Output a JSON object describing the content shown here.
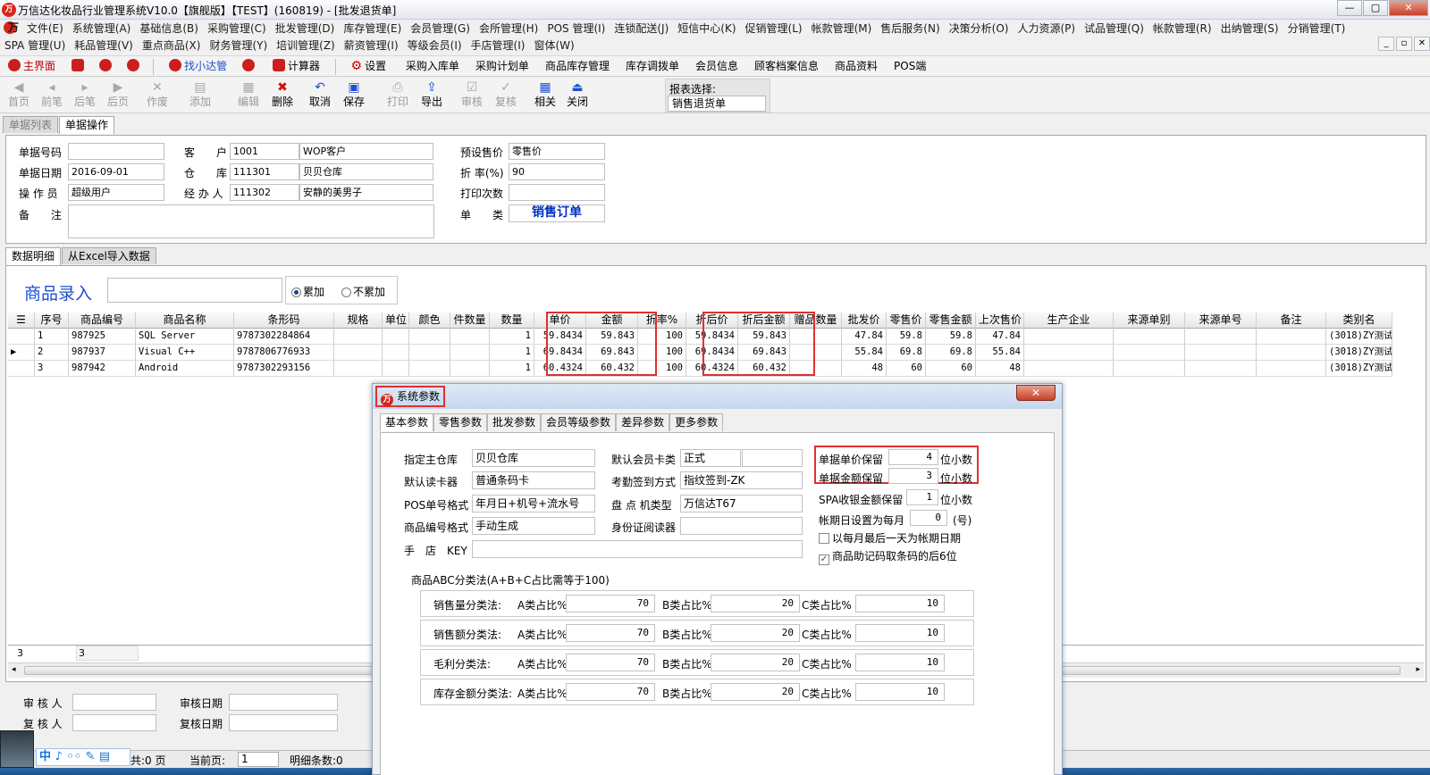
{
  "window": {
    "title": "万信达化妆品行业管理系统V10.0【旗舰版】【TEST】(160819) - [批发退货单]",
    "logo_text": "万",
    "minimize": "—",
    "maximize": "▢",
    "close": "✕"
  },
  "menu1": [
    "文件(E)",
    "系统管理(A)",
    "基础信息(B)",
    "采购管理(C)",
    "批发管理(D)",
    "库存管理(E)",
    "会员管理(G)",
    "会所管理(H)",
    "POS 管理(I)",
    "连锁配送(J)",
    "短信中心(K)",
    "促销管理(L)",
    "帐款管理(M)",
    "售后服务(N)",
    "决策分析(O)",
    "人力资源(P)",
    "试品管理(Q)",
    "帐款管理(R)",
    "出纳管理(S)",
    "分销管理(T)"
  ],
  "menu2": [
    "SPA 管理(U)",
    "耗品管理(V)",
    "重点商品(X)",
    "财务管理(Y)",
    "培训管理(Z)",
    "薪资管理(I)",
    "等级会员(I)",
    "手店管理(I)",
    "窗体(W)"
  ],
  "mdi_buttons": [
    "_",
    "▫",
    "✕"
  ],
  "quickbar": {
    "main": "主界面",
    "find": "找小达管",
    "calc": "计算器",
    "settings": "设置",
    "links": [
      "采购入库单",
      "采购计划单",
      "商品库存管理",
      "库存调拨单",
      "会员信息",
      "顾客档案信息",
      "商品资料",
      "POS端"
    ]
  },
  "toolbar": [
    {
      "label": "首页",
      "icon": "◀",
      "enabled": false
    },
    {
      "label": "前笔",
      "icon": "◂",
      "enabled": false
    },
    {
      "label": "后笔",
      "icon": "▸",
      "enabled": false
    },
    {
      "label": "后页",
      "icon": "▶",
      "enabled": false
    },
    {
      "label": "作废",
      "icon": "✕",
      "enabled": false
    },
    {
      "label": "添加",
      "icon": "▤",
      "enabled": false
    },
    {
      "label": "编辑",
      "icon": "▦",
      "enabled": false
    },
    {
      "label": "删除",
      "icon": "✖",
      "enabled": true
    },
    {
      "label": "取消",
      "icon": "↶",
      "enabled": true
    },
    {
      "label": "保存",
      "icon": "▣",
      "enabled": true
    },
    {
      "label": "打印",
      "icon": "⎙",
      "enabled": false
    },
    {
      "label": "导出",
      "icon": "⇪",
      "enabled": true
    },
    {
      "label": "审核",
      "icon": "☑",
      "enabled": false
    },
    {
      "label": "复核",
      "icon": "✓",
      "enabled": false
    },
    {
      "label": "相关",
      "icon": "▦",
      "enabled": true
    },
    {
      "label": "关闭",
      "icon": "⏏",
      "enabled": true
    }
  ],
  "report_select": {
    "label": "报表选择:",
    "value": "销售退货单"
  },
  "top_tabs": [
    "单据列表",
    "单据操作"
  ],
  "form": {
    "bill_no_label": "单据号码",
    "bill_no": "",
    "bill_date_label": "单据日期",
    "bill_date": "2016-09-01",
    "operator_label": "操 作 员",
    "operator": "超级用户",
    "remark_label": "备　　注",
    "remark": "",
    "customer_label": "客　　户",
    "customer_code": "1001",
    "customer_name": "WOP客户",
    "warehouse_label": "仓　　库",
    "warehouse_code": "111301",
    "warehouse_name": "贝贝仓库",
    "handler_label": "经 办 人",
    "handler_code": "111302",
    "handler_name": "安静的美男子",
    "price_label": "预设售价",
    "price": "零售价",
    "discount_label": "折 率(%)",
    "discount": "90",
    "print_label": "打印次数",
    "print_count": "",
    "type_label": "单　　类",
    "type": "销售订单"
  },
  "detail_tabs": [
    "数据明细",
    "从Excel导入数据"
  ],
  "entry": {
    "label": "商品录入",
    "value": "",
    "mode_add": "累加",
    "mode_noadd": "不累加"
  },
  "grid": {
    "columns": [
      "",
      "序号",
      "商品编号",
      "商品名称",
      "条形码",
      "规格",
      "单位",
      "颜色",
      "件数量",
      "数量",
      "单价",
      "金额",
      "折率%",
      "折后价",
      "折后金额",
      "赠品数量",
      "批发价",
      "零售价",
      "零售金额",
      "上次售价",
      "生产企业",
      "来源单别",
      "来源单号",
      "备注",
      "类别名"
    ],
    "rows": [
      [
        "",
        "1",
        "987925",
        "SQL Server",
        "9787302284864",
        "",
        "",
        "",
        "",
        "1",
        "59.8434",
        "59.843",
        "100",
        "59.8434",
        "59.843",
        "",
        "47.84",
        "59.8",
        "59.8",
        "47.84",
        "",
        "",
        "",
        "",
        "(3018)ZY测试"
      ],
      [
        "▶",
        "2",
        "987937",
        "Visual C++",
        "9787806776933",
        "",
        "",
        "",
        "",
        "1",
        "69.8434",
        "69.843",
        "100",
        "69.8434",
        "69.843",
        "",
        "55.84",
        "69.8",
        "69.8",
        "55.84",
        "",
        "",
        "",
        "",
        "(3018)ZY测试"
      ],
      [
        "",
        "3",
        "987942",
        "Android",
        "9787302293156",
        "",
        "",
        "",
        "",
        "1",
        "60.4324",
        "60.432",
        "100",
        "60.4324",
        "60.432",
        "",
        "48",
        "60",
        "60",
        "48",
        "",
        "",
        "",
        "",
        "(3018)ZY测试"
      ]
    ],
    "footer_count": "3",
    "footer_sum": "3"
  },
  "audit": {
    "auditor_label": "审 核 人",
    "auditor": "",
    "audit_date_label": "审核日期",
    "audit_date": "",
    "reviewer_label": "复 核 人",
    "reviewer": "",
    "review_date_label": "复核日期",
    "review_date": ""
  },
  "status": {
    "total_pages": "共:0 页",
    "current_page_label": "当前页:",
    "current_page": "1",
    "detail_count": "明细条数:0"
  },
  "ime": {
    "text": "中 ♪ ◦◦ ✎ ▤"
  },
  "dialog": {
    "title": "系统参数",
    "tabs": [
      "基本参数",
      "零售参数",
      "批发参数",
      "会员等级参数",
      "差异参数",
      "更多参数"
    ],
    "main_wh_label": "指定主仓库",
    "main_wh": "贝贝仓库",
    "card_reader_label": "默认读卡器",
    "card_reader": "普通条码卡",
    "pos_fmt_label": "POS单号格式",
    "pos_fmt": "年月日+机号+流水号",
    "item_fmt_label": "商品编号格式",
    "item_fmt": "手动生成",
    "shop_key_label": "手　店　KEY",
    "shop_key": "",
    "member_card_label": "默认会员卡类",
    "member_card": "正式",
    "member_card2": "",
    "attendance_label": "考勤签到方式",
    "attendance": "指纹签到-ZK",
    "stock_machine_label": "盘 点 机类型",
    "stock_machine": "万信达T67",
    "id_reader_label": "身份证阅读器",
    "id_reader": "",
    "price_dec_label": "单据单价保留",
    "price_dec": "4",
    "price_dec_unit": "位小数",
    "amt_dec_label": "单据金额保留",
    "amt_dec": "3",
    "amt_dec_unit": "位小数",
    "spa_dec_label": "SPA收银金额保留",
    "spa_dec": "1",
    "spa_dec_unit": "位小数",
    "period_label": "帐期日设置为每月",
    "period": "0",
    "period_unit": "(号)",
    "chk_last_day": "以每月最后一天为帐期日期",
    "chk_last6": "商品助记码取条码的后6位",
    "abc_title": "商品ABC分类法(A+B+C占比需等于100)",
    "abc_rows": [
      {
        "label": "销售量分类法:",
        "a_label": "A类占比%",
        "a": "70",
        "b_label": "B类占比%",
        "b": "20",
        "c_label": "C类占比%",
        "c": "10"
      },
      {
        "label": "销售额分类法:",
        "a_label": "A类占比%",
        "a": "70",
        "b_label": "B类占比%",
        "b": "20",
        "c_label": "C类占比%",
        "c": "10"
      },
      {
        "label": "毛利分类法:",
        "a_label": "A类占比%",
        "a": "70",
        "b_label": "B类占比%",
        "b": "20",
        "c_label": "C类占比%",
        "c": "10"
      },
      {
        "label": "库存金额分类法:",
        "a_label": "A类占比%",
        "a": "70",
        "b_label": "B类占比%",
        "b": "20",
        "c_label": "C类占比%",
        "c": "10"
      }
    ],
    "close": "✕"
  },
  "colors": {
    "highlight": "#e03030",
    "accent_blue": "#1f4fd0"
  }
}
